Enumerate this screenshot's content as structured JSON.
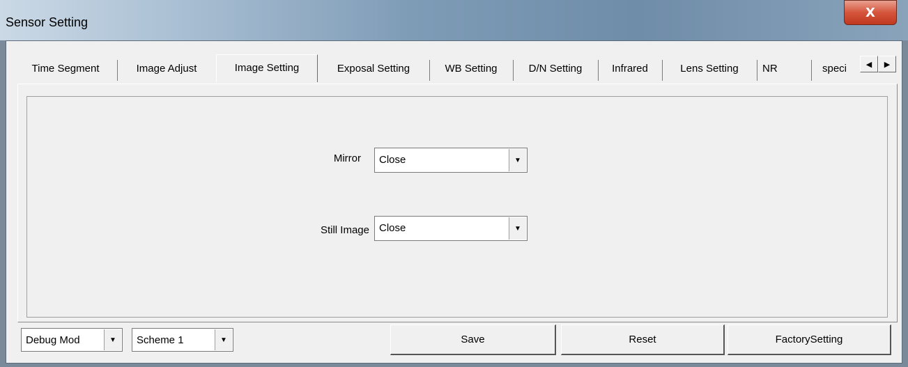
{
  "window": {
    "title": "Sensor Setting",
    "close_label": "X"
  },
  "tabs": [
    {
      "label": "Time Segment"
    },
    {
      "label": "Image Adjust"
    },
    {
      "label": "Image Setting",
      "active": true
    },
    {
      "label": "Exposal Setting"
    },
    {
      "label": "WB Setting"
    },
    {
      "label": "D/N Setting"
    },
    {
      "label": "Infrared"
    },
    {
      "label": "Lens Setting"
    },
    {
      "label": "NR"
    },
    {
      "label": "speci"
    }
  ],
  "tab_scroll": {
    "left_icon": "◀",
    "right_icon": "▶"
  },
  "form": {
    "mirror": {
      "label": "Mirror",
      "value": "Close"
    },
    "still_image": {
      "label": "Still Image",
      "value": "Close"
    }
  },
  "footer": {
    "mode_select": {
      "value": "Debug Mod"
    },
    "scheme_select": {
      "value": "Scheme 1"
    },
    "save_label": "Save",
    "reset_label": "Reset",
    "factory_label": "FactorySetting"
  },
  "icons": {
    "dropdown": "▼"
  }
}
